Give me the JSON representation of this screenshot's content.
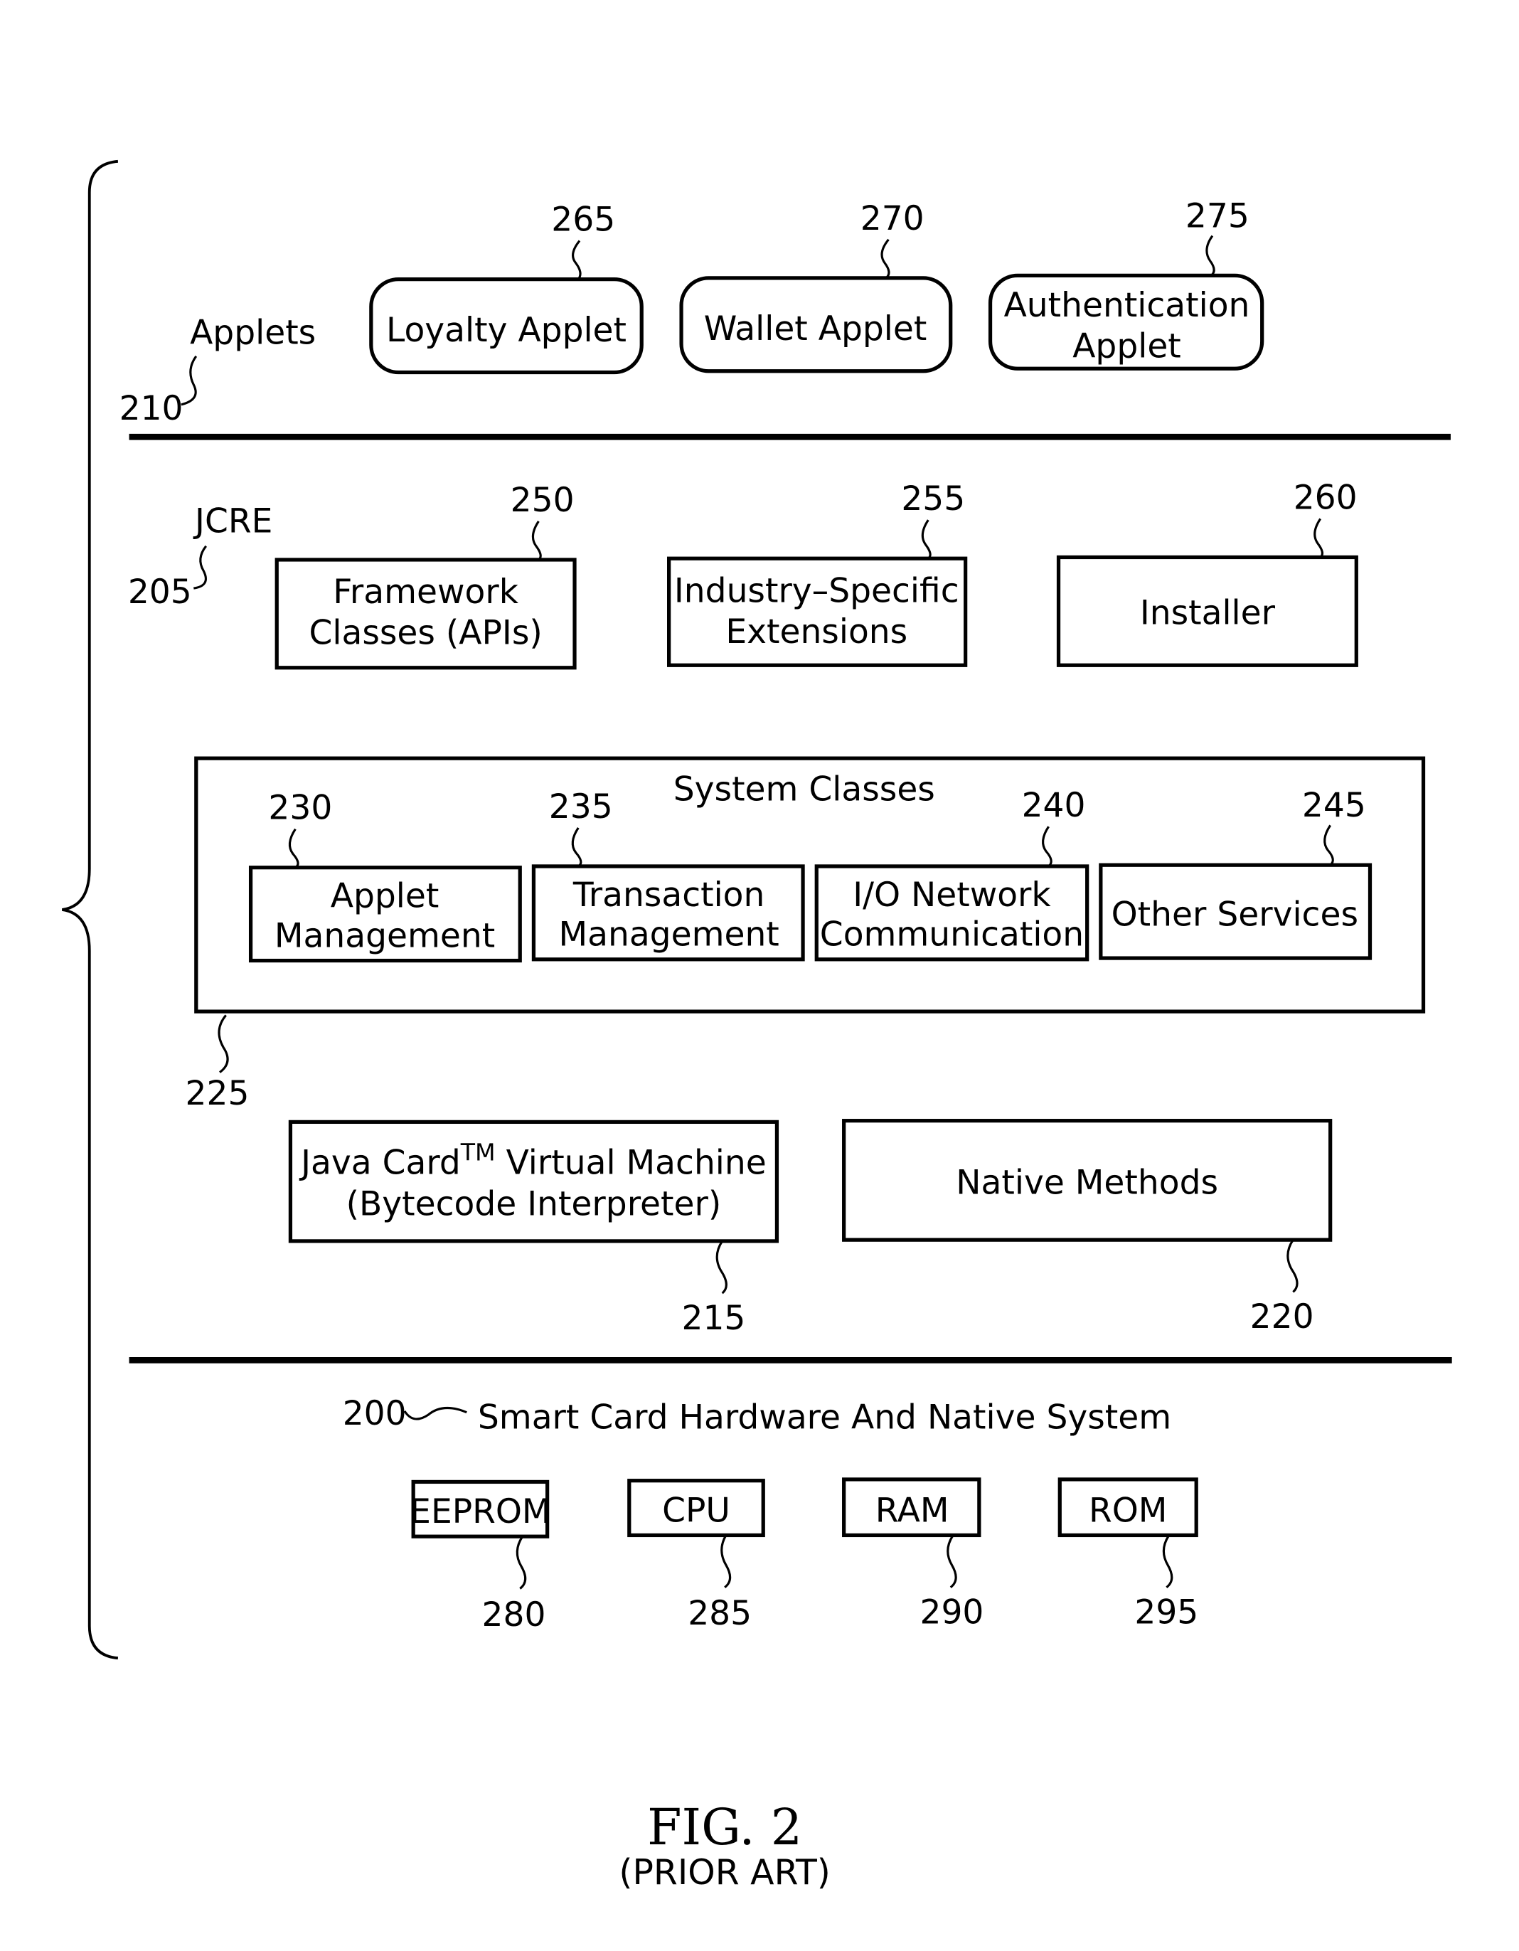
{
  "figure": {
    "title": "FIG. 2",
    "subtitle": "(PRIOR ART)"
  },
  "layers": {
    "applets": {
      "label": "Applets",
      "ref": "210",
      "items": [
        {
          "ref": "265",
          "lines": [
            "Loyalty Applet"
          ]
        },
        {
          "ref": "270",
          "lines": [
            "Wallet Applet"
          ]
        },
        {
          "ref": "275",
          "lines": [
            "Authentication",
            "Applet"
          ]
        }
      ]
    },
    "jcre": {
      "label": "JCRE",
      "ref": "205",
      "items": [
        {
          "ref": "250",
          "lines": [
            "Framework",
            "Classes (APIs)"
          ]
        },
        {
          "ref": "255",
          "lines": [
            "Industry–Specific",
            "Extensions"
          ]
        },
        {
          "ref": "260",
          "lines": [
            "Installer"
          ]
        }
      ],
      "system_classes": {
        "label": "System Classes",
        "ref": "225",
        "items": [
          {
            "ref": "230",
            "lines": [
              "Applet",
              "Management"
            ]
          },
          {
            "ref": "235",
            "lines": [
              "Transaction",
              "Management"
            ]
          },
          {
            "ref": "240",
            "lines": [
              "I/O Network",
              "Communication"
            ]
          },
          {
            "ref": "245",
            "lines": [
              "Other Services"
            ]
          }
        ]
      },
      "vm": {
        "ref": "215",
        "line1_prefix": "Java Card",
        "trademark": "TM",
        "line1_suffix": " Virtual Machine",
        "line2": "(Bytecode Interpreter)"
      },
      "native": {
        "ref": "220",
        "lines": [
          "Native Methods"
        ]
      }
    },
    "hardware": {
      "label": "Smart Card Hardware And Native System",
      "ref": "200",
      "items": [
        {
          "ref": "280",
          "lines": [
            "EEPROM"
          ]
        },
        {
          "ref": "285",
          "lines": [
            "CPU"
          ]
        },
        {
          "ref": "290",
          "lines": [
            "RAM"
          ]
        },
        {
          "ref": "295",
          "lines": [
            "ROM"
          ]
        }
      ]
    }
  }
}
